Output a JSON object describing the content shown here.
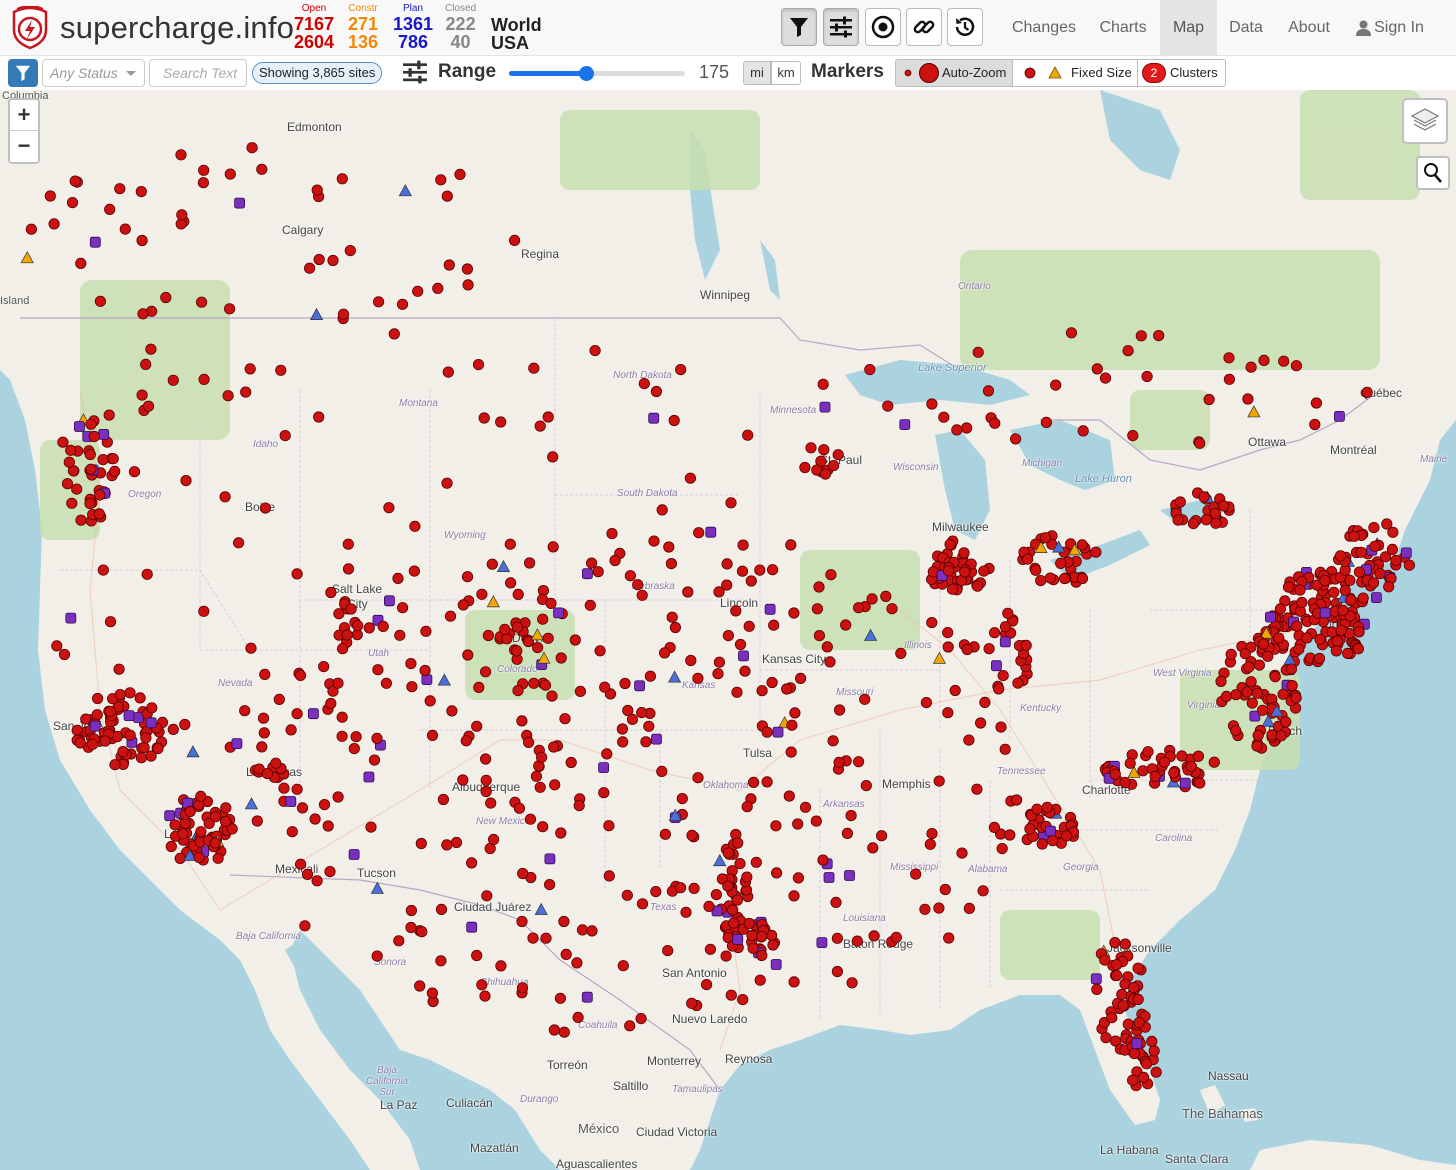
{
  "brand": {
    "name": "supercharge.info"
  },
  "counts": {
    "open": {
      "caption": "Open",
      "world": "7167",
      "region": "2604",
      "color": "#d10000"
    },
    "constr": {
      "caption": "Constr",
      "world": "271",
      "region": "136",
      "color": "#f0890a"
    },
    "plan": {
      "caption": "Plan",
      "world": "1361",
      "region": "786",
      "color": "#1a1ac8"
    },
    "closed": {
      "caption": "Closed",
      "world": "222",
      "region": "40",
      "color": "#888888"
    },
    "world_label": "World",
    "region_label": "USA"
  },
  "tools": [
    "filter-icon",
    "sliders-icon",
    "target-icon",
    "link-icon",
    "history-icon"
  ],
  "nav": {
    "changes": "Changes",
    "charts": "Charts",
    "map": "Map",
    "data": "Data",
    "about": "About",
    "signin": "Sign In",
    "active": "Map"
  },
  "toolbar": {
    "status_placeholder": "Any Status",
    "search_placeholder": "Search Text",
    "showing": "Showing 3,865 sites",
    "range_label": "Range",
    "range_value": "175",
    "range_fraction": 0.44,
    "unit_mi": "mi",
    "unit_km": "km",
    "selected_unit": "mi",
    "markers_label": "Markers",
    "auto_zoom": "Auto-Zoom",
    "fixed_size": "Fixed Size",
    "clusters": "Clusters",
    "cluster_count": "2"
  },
  "map": {
    "zoom_in": "+",
    "zoom_out": "−",
    "marker_colors": {
      "open": "#cc1111",
      "planned": "#7a2fbf",
      "construction": "#f2a600",
      "plan_triangle": "#4a6fd8"
    },
    "labels": {
      "columbia": "Columbia",
      "vancouver_island": "Island",
      "edmonton": "Edmonton",
      "calgary": "Calgary",
      "regina": "Regina",
      "winnipeg": "Winnipeg",
      "ontario": "Ontario",
      "quebec": "Québec",
      "ottawa": "Ottawa",
      "montreal": "Montréal",
      "maine": "Maine",
      "lake_superior": "Lake Superior",
      "lake_huron": "Lake Huron",
      "michigan": "Michigan",
      "north_dakota": "North Dakota",
      "south_dakota": "South Dakota",
      "montana": "Montana",
      "minnesota": "Minnesota",
      "st_paul": "St. Paul",
      "wisconsin": "Wisconsin",
      "milwaukee": "Milwaukee",
      "idaho": "Idaho",
      "oregon": "Oregon",
      "boise": "Boise",
      "wyoming": "Wyoming",
      "nebraska": "Nebraska",
      "lincoln": "Lincoln",
      "salt_lake": "Salt Lake",
      "city": "City",
      "nevada": "Nevada",
      "utah": "Utah",
      "colorado": "Colorado",
      "denver": "Denver",
      "kansas": "Kansas",
      "kansas_city": "Kansas City",
      "missouri": "Missouri",
      "illinois": "Illinois",
      "kentucky": "Kentucky",
      "virginia": "Virginia",
      "west_virginia": "West Virginia",
      "new_york": "York",
      "beach": "Beach",
      "san_jose": "San Jose",
      "los": "Los",
      "las_vegas": "Las Vegas",
      "albuquerque": "Albuquerque",
      "oklahoma": "Oklahoma",
      "tulsa": "Tulsa",
      "memphis": "Memphis",
      "arkansas": "Arkansas",
      "tennessee": "Tennessee",
      "charlotte": "Charlotte",
      "carolina": "Carolina",
      "new_mexico": "New Mexico",
      "tucson": "Tucson",
      "mexicali": "Mexicali",
      "ciudad_juarez": "Ciudad Juárez",
      "texas": "Texas",
      "louisiana": "Louisiana",
      "baton_rouge": "Baton Rouge",
      "mississippi": "Mississippi",
      "alabama": "Alabama",
      "georgia": "Georgia",
      "jacksonville": "Jacksonville",
      "san_antonio": "San Antonio",
      "nuevo_laredo": "Nuevo Laredo",
      "baja_california": "Baja California",
      "sonora": "Sonora",
      "chihuahua": "Chihuahua",
      "coahuila": "Coahuila",
      "monterrey": "Monterrey",
      "torreon": "Torreón",
      "saltillo": "Saltillo",
      "tamaulipas": "Tamaulipas",
      "baja_california_sur": "Baja California Sur",
      "la_paz": "La Paz",
      "culiacan": "Culiacán",
      "durango": "Durango",
      "mexico": "México",
      "ciudad_victoria": "Ciudad Victoria",
      "mazatlan": "Mazatlán",
      "aguascalientes": "Aguascalientes",
      "nassau": "Nassau",
      "the_bahamas": "The Bahamas",
      "la_habana": "La Habana",
      "santa_clara": "Santa Clara",
      "reynosa": "Reynosa"
    }
  }
}
